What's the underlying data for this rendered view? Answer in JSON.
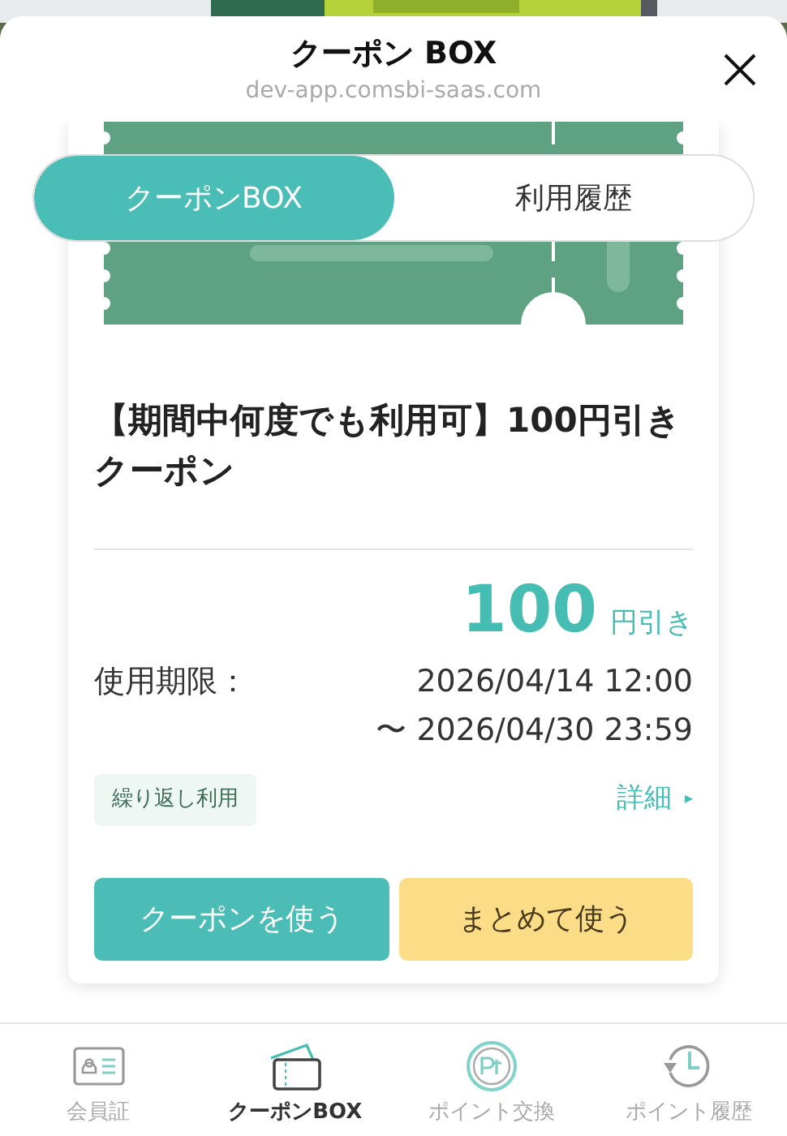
{
  "header": {
    "title": "クーポン BOX",
    "url": "dev-app.comsbi-saas.com"
  },
  "tabs": [
    {
      "label": "クーポンBOX",
      "selected": true
    },
    {
      "label": "利用履歴",
      "selected": false
    }
  ],
  "coupon": {
    "title": "【期間中何度でも利用可】100円引きクーポン",
    "amount": "100",
    "amount_unit": "円引き",
    "validity_label": "使用期限：",
    "validity_start": "2026/04/14 12:00",
    "validity_end": "〜 2026/04/30 23:59",
    "tag": "繰り返し利用",
    "details_link": "詳細",
    "details_arrow": "▸",
    "buttons": [
      {
        "label": "クーポンを使う",
        "kind": "primary"
      },
      {
        "label": "まとめて使う",
        "kind": "secondary"
      }
    ]
  },
  "bottom_nav": [
    {
      "label": "会員証",
      "kind": "card",
      "selected": false
    },
    {
      "label": "クーポンBOX",
      "kind": "coupon",
      "selected": true
    },
    {
      "label": "ポイント交換",
      "kind": "points",
      "selected": false
    },
    {
      "label": "ポイント履歴",
      "kind": "history",
      "selected": false
    }
  ]
}
